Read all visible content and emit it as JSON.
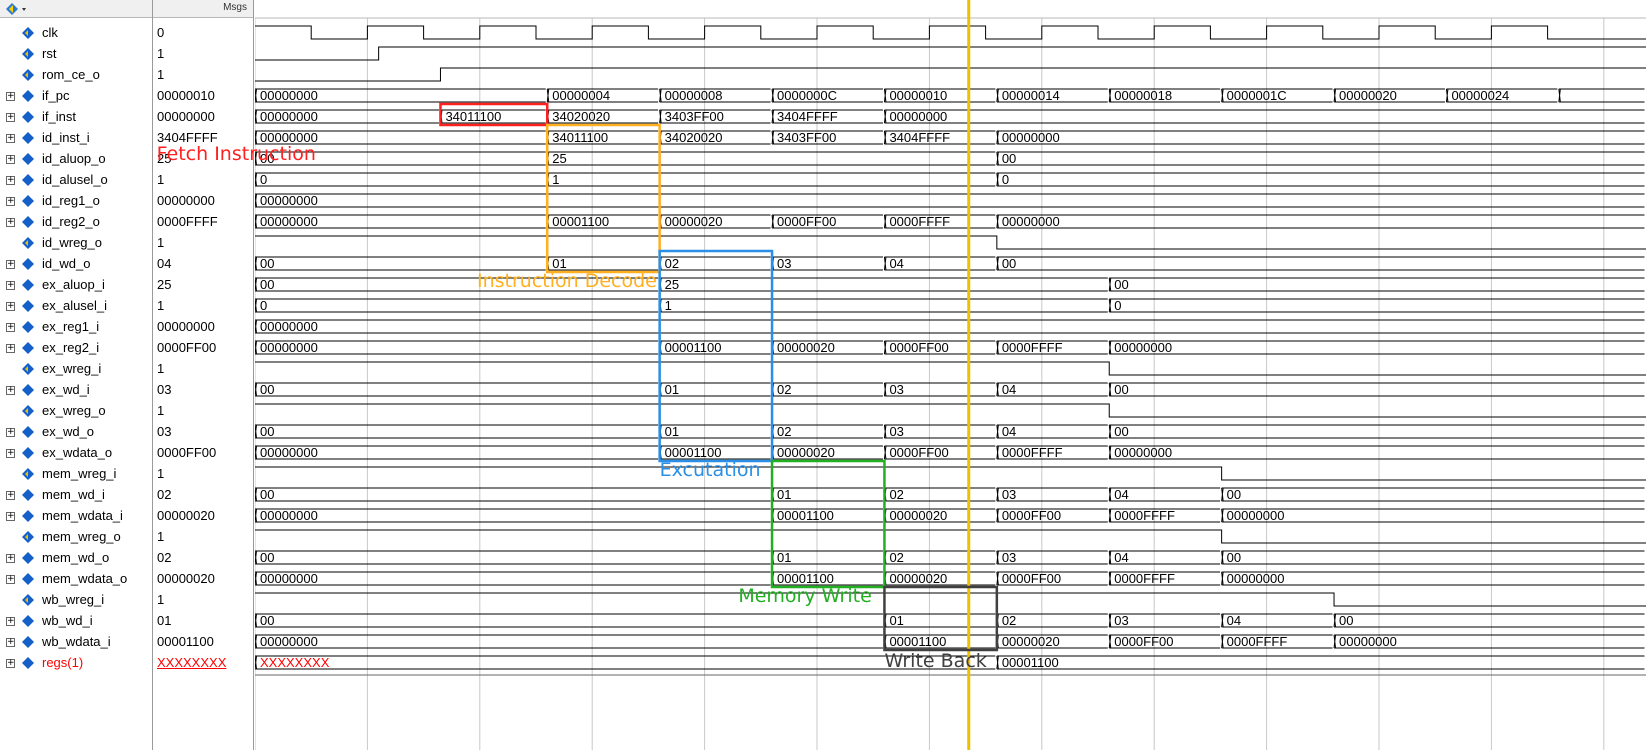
{
  "header": {
    "msgs_label": "Msgs"
  },
  "signals": [
    {
      "name": "clk",
      "value": "0",
      "kind": "bit",
      "expand": false,
      "waveform": [
        [
          0,
          1
        ],
        [
          1,
          0
        ],
        [
          2,
          1
        ],
        [
          3,
          0
        ],
        [
          4,
          1
        ],
        [
          5,
          0
        ],
        [
          6,
          1
        ],
        [
          7,
          0
        ],
        [
          8,
          1
        ],
        [
          9,
          0
        ],
        [
          10,
          1
        ],
        [
          11,
          0
        ],
        [
          12,
          1
        ],
        [
          13,
          0
        ],
        [
          14,
          1
        ],
        [
          15,
          0
        ],
        [
          16,
          1
        ],
        [
          17,
          0
        ],
        [
          18,
          1
        ],
        [
          19,
          0
        ],
        [
          20,
          1
        ],
        [
          21,
          0
        ],
        [
          22,
          1
        ],
        [
          23,
          0
        ]
      ]
    },
    {
      "name": "rst",
      "value": "1",
      "kind": "bit",
      "expand": false,
      "waveform": [
        [
          0,
          0
        ],
        [
          2.2,
          1
        ]
      ]
    },
    {
      "name": "rom_ce_o",
      "value": "1",
      "kind": "bit",
      "expand": false,
      "waveform": [
        [
          0,
          0
        ],
        [
          3.3,
          1
        ]
      ]
    },
    {
      "name": "if_pc",
      "value": "00000010",
      "kind": "bus",
      "expand": true,
      "segments": [
        [
          0,
          "00000000"
        ],
        [
          5.2,
          "00000004"
        ],
        [
          7.2,
          "00000008"
        ],
        [
          9.2,
          "0000000C"
        ],
        [
          11.2,
          "00000010"
        ],
        [
          13.2,
          "00000014"
        ],
        [
          15.2,
          "00000018"
        ],
        [
          17.2,
          "0000001C"
        ],
        [
          19.2,
          "00000020"
        ],
        [
          21.2,
          "00000024"
        ],
        [
          23.2,
          ""
        ]
      ]
    },
    {
      "name": "if_inst",
      "value": "00000000",
      "kind": "bus",
      "expand": true,
      "segments": [
        [
          0,
          "00000000"
        ],
        [
          3.3,
          "34011100"
        ],
        [
          5.2,
          "34020020"
        ],
        [
          7.2,
          "3403FF00"
        ],
        [
          9.2,
          "3404FFFF"
        ],
        [
          11.2,
          "00000000"
        ]
      ]
    },
    {
      "name": "id_inst_i",
      "value": "3404FFFF",
      "kind": "bus",
      "expand": true,
      "segments": [
        [
          0,
          "00000000"
        ],
        [
          5.2,
          "34011100"
        ],
        [
          7.2,
          "34020020"
        ],
        [
          9.2,
          "3403FF00"
        ],
        [
          11.2,
          "3404FFFF"
        ],
        [
          13.2,
          "00000000"
        ]
      ]
    },
    {
      "name": "id_aluop_o",
      "value": "25",
      "kind": "bus",
      "expand": true,
      "segments": [
        [
          0,
          "00"
        ],
        [
          5.2,
          "25"
        ],
        [
          13.2,
          "00"
        ]
      ]
    },
    {
      "name": "id_alusel_o",
      "value": "1",
      "kind": "bus",
      "expand": true,
      "segments": [
        [
          0,
          "0"
        ],
        [
          5.2,
          "1"
        ],
        [
          13.2,
          "0"
        ]
      ]
    },
    {
      "name": "id_reg1_o",
      "value": "00000000",
      "kind": "bus",
      "expand": true,
      "segments": [
        [
          0,
          "00000000"
        ]
      ]
    },
    {
      "name": "id_reg2_o",
      "value": "0000FFFF",
      "kind": "bus",
      "expand": true,
      "segments": [
        [
          0,
          "00000000"
        ],
        [
          5.2,
          "00001100"
        ],
        [
          7.2,
          "00000020"
        ],
        [
          9.2,
          "0000FF00"
        ],
        [
          11.2,
          "0000FFFF"
        ],
        [
          13.2,
          "00000000"
        ]
      ]
    },
    {
      "name": "id_wreg_o",
      "value": "1",
      "kind": "bit",
      "expand": false,
      "waveform": [
        [
          0,
          1
        ],
        [
          13.2,
          0
        ]
      ]
    },
    {
      "name": "id_wd_o",
      "value": "04",
      "kind": "bus",
      "expand": true,
      "segments": [
        [
          0,
          "00"
        ],
        [
          5.2,
          "01"
        ],
        [
          7.2,
          "02"
        ],
        [
          9.2,
          "03"
        ],
        [
          11.2,
          "04"
        ],
        [
          13.2,
          "00"
        ]
      ]
    },
    {
      "name": "ex_aluop_i",
      "value": "25",
      "kind": "bus",
      "expand": true,
      "segments": [
        [
          0,
          "00"
        ],
        [
          7.2,
          "25"
        ],
        [
          15.2,
          "00"
        ]
      ]
    },
    {
      "name": "ex_alusel_i",
      "value": "1",
      "kind": "bus",
      "expand": true,
      "segments": [
        [
          0,
          "0"
        ],
        [
          7.2,
          "1"
        ],
        [
          15.2,
          "0"
        ]
      ]
    },
    {
      "name": "ex_reg1_i",
      "value": "00000000",
      "kind": "bus",
      "expand": true,
      "segments": [
        [
          0,
          "00000000"
        ]
      ]
    },
    {
      "name": "ex_reg2_i",
      "value": "0000FF00",
      "kind": "bus",
      "expand": true,
      "segments": [
        [
          0,
          "00000000"
        ],
        [
          7.2,
          "00001100"
        ],
        [
          9.2,
          "00000020"
        ],
        [
          11.2,
          "0000FF00"
        ],
        [
          13.2,
          "0000FFFF"
        ],
        [
          15.2,
          "00000000"
        ]
      ]
    },
    {
      "name": "ex_wreg_i",
      "value": "1",
      "kind": "bit",
      "expand": false,
      "waveform": [
        [
          0,
          1
        ],
        [
          15.2,
          0
        ]
      ]
    },
    {
      "name": "ex_wd_i",
      "value": "03",
      "kind": "bus",
      "expand": true,
      "segments": [
        [
          0,
          "00"
        ],
        [
          7.2,
          "01"
        ],
        [
          9.2,
          "02"
        ],
        [
          11.2,
          "03"
        ],
        [
          13.2,
          "04"
        ],
        [
          15.2,
          "00"
        ]
      ]
    },
    {
      "name": "ex_wreg_o",
      "value": "1",
      "kind": "bit",
      "expand": false,
      "waveform": [
        [
          0,
          1
        ],
        [
          15.2,
          0
        ]
      ]
    },
    {
      "name": "ex_wd_o",
      "value": "03",
      "kind": "bus",
      "expand": true,
      "segments": [
        [
          0,
          "00"
        ],
        [
          7.2,
          "01"
        ],
        [
          9.2,
          "02"
        ],
        [
          11.2,
          "03"
        ],
        [
          13.2,
          "04"
        ],
        [
          15.2,
          "00"
        ]
      ]
    },
    {
      "name": "ex_wdata_o",
      "value": "0000FF00",
      "kind": "bus",
      "expand": true,
      "segments": [
        [
          0,
          "00000000"
        ],
        [
          7.2,
          "00001100"
        ],
        [
          9.2,
          "00000020"
        ],
        [
          11.2,
          "0000FF00"
        ],
        [
          13.2,
          "0000FFFF"
        ],
        [
          15.2,
          "00000000"
        ]
      ]
    },
    {
      "name": "mem_wreg_i",
      "value": "1",
      "kind": "bit",
      "expand": false,
      "waveform": [
        [
          0,
          1
        ],
        [
          17.2,
          0
        ]
      ]
    },
    {
      "name": "mem_wd_i",
      "value": "02",
      "kind": "bus",
      "expand": true,
      "segments": [
        [
          0,
          "00"
        ],
        [
          9.2,
          "01"
        ],
        [
          11.2,
          "02"
        ],
        [
          13.2,
          "03"
        ],
        [
          15.2,
          "04"
        ],
        [
          17.2,
          "00"
        ]
      ]
    },
    {
      "name": "mem_wdata_i",
      "value": "00000020",
      "kind": "bus",
      "expand": true,
      "segments": [
        [
          0,
          "00000000"
        ],
        [
          9.2,
          "00001100"
        ],
        [
          11.2,
          "00000020"
        ],
        [
          13.2,
          "0000FF00"
        ],
        [
          15.2,
          "0000FFFF"
        ],
        [
          17.2,
          "00000000"
        ]
      ]
    },
    {
      "name": "mem_wreg_o",
      "value": "1",
      "kind": "bit",
      "expand": false,
      "waveform": [
        [
          0,
          1
        ],
        [
          17.2,
          0
        ]
      ]
    },
    {
      "name": "mem_wd_o",
      "value": "02",
      "kind": "bus",
      "expand": true,
      "segments": [
        [
          0,
          "00"
        ],
        [
          9.2,
          "01"
        ],
        [
          11.2,
          "02"
        ],
        [
          13.2,
          "03"
        ],
        [
          15.2,
          "04"
        ],
        [
          17.2,
          "00"
        ]
      ]
    },
    {
      "name": "mem_wdata_o",
      "value": "00000020",
      "kind": "bus",
      "expand": true,
      "segments": [
        [
          0,
          "00000000"
        ],
        [
          9.2,
          "00001100"
        ],
        [
          11.2,
          "00000020"
        ],
        [
          13.2,
          "0000FF00"
        ],
        [
          15.2,
          "0000FFFF"
        ],
        [
          17.2,
          "00000000"
        ]
      ]
    },
    {
      "name": "wb_wreg_i",
      "value": "1",
      "kind": "bit",
      "expand": false,
      "waveform": [
        [
          0,
          1
        ],
        [
          19.2,
          0
        ]
      ]
    },
    {
      "name": "wb_wd_i",
      "value": "01",
      "kind": "bus",
      "expand": true,
      "segments": [
        [
          0,
          "00"
        ],
        [
          11.2,
          "01"
        ],
        [
          13.2,
          "02"
        ],
        [
          15.2,
          "03"
        ],
        [
          17.2,
          "04"
        ],
        [
          19.2,
          "00"
        ]
      ]
    },
    {
      "name": "wb_wdata_i",
      "value": "00001100",
      "kind": "bus",
      "expand": true,
      "segments": [
        [
          0,
          "00000000"
        ],
        [
          11.2,
          "00001100"
        ],
        [
          13.2,
          "00000020"
        ],
        [
          15.2,
          "0000FF00"
        ],
        [
          17.2,
          "0000FFFF"
        ],
        [
          19.2,
          "00000000"
        ]
      ]
    },
    {
      "name": "regs(1)",
      "value": "XXXXXXXX",
      "kind": "bus",
      "expand": true,
      "red": true,
      "segments": [
        [
          0,
          "XXXXXXXX"
        ],
        [
          13.2,
          "00001100"
        ]
      ]
    }
  ],
  "annotations": [
    {
      "label": "Fetch Instruction",
      "color": "#ff2020"
    },
    {
      "label": "Instruction Decode",
      "color": "#ffb020"
    },
    {
      "label": "Excutation",
      "color": "#2a8fe6"
    },
    {
      "label": "Memory Write",
      "color": "#22b022"
    },
    {
      "label": "Write Back",
      "color": "#404040"
    }
  ],
  "colors": {
    "signal_icon": "#1560c8",
    "wave": "#000000",
    "cursor": "#f0c000",
    "grid": "#c8c8c8",
    "red_text": "#ff0000"
  }
}
